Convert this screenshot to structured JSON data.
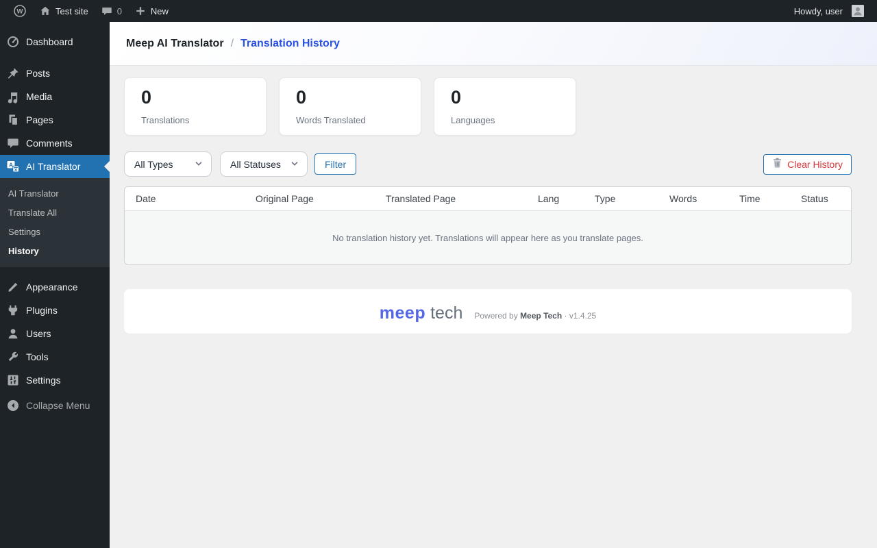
{
  "admin_bar": {
    "site_name": "Test site",
    "comments_count": "0",
    "new_label": "New",
    "howdy": "Howdy, user"
  },
  "sidebar": {
    "items": [
      {
        "label": "Dashboard"
      },
      {
        "label": "Posts"
      },
      {
        "label": "Media"
      },
      {
        "label": "Pages"
      },
      {
        "label": "Comments"
      },
      {
        "label": "AI Translator",
        "active": true
      },
      {
        "label": "Appearance"
      },
      {
        "label": "Plugins"
      },
      {
        "label": "Users"
      },
      {
        "label": "Tools"
      },
      {
        "label": "Settings"
      },
      {
        "label": "Collapse Menu"
      }
    ],
    "submenu": [
      {
        "label": "AI Translator"
      },
      {
        "label": "Translate All"
      },
      {
        "label": "Settings"
      },
      {
        "label": "History",
        "current": true
      }
    ]
  },
  "breadcrumb": {
    "parent": "Meep AI Translator",
    "separator": "/",
    "current": "Translation History"
  },
  "stats": [
    {
      "value": "0",
      "label": "Translations"
    },
    {
      "value": "0",
      "label": "Words Translated"
    },
    {
      "value": "0",
      "label": "Languages"
    }
  ],
  "filters": {
    "type_value": "All Types",
    "status_value": "All Statuses",
    "filter_label": "Filter",
    "clear_label": "Clear History"
  },
  "table": {
    "columns": [
      "Date",
      "Original Page",
      "Translated Page",
      "Lang",
      "Type",
      "Words",
      "Time",
      "Status"
    ],
    "empty_message": "No translation history yet. Translations will appear here as you translate pages."
  },
  "footer": {
    "logo_primary": "meep",
    "logo_secondary": "tech",
    "powered_prefix": "Powered by ",
    "brand_name": "Meep Tech",
    "version_suffix": " · v1.4.25"
  },
  "icons": {
    "wp_logo": "wordpress-logo-icon",
    "home": "home-icon",
    "comment_bubble": "comment-bubble-icon",
    "plus": "plus-icon",
    "trash": "trash-icon",
    "chevron": "chevron-down-icon"
  },
  "colors": {
    "admin_dark": "#1d2327",
    "submenu_dark": "#2c3338",
    "active_menu_blue": "#2271b1",
    "breadcrumb_link_blue": "#2a52e0",
    "danger_red": "#d63638",
    "logo_blue": "#5468e7",
    "content_bg": "#f0f0f1"
  }
}
